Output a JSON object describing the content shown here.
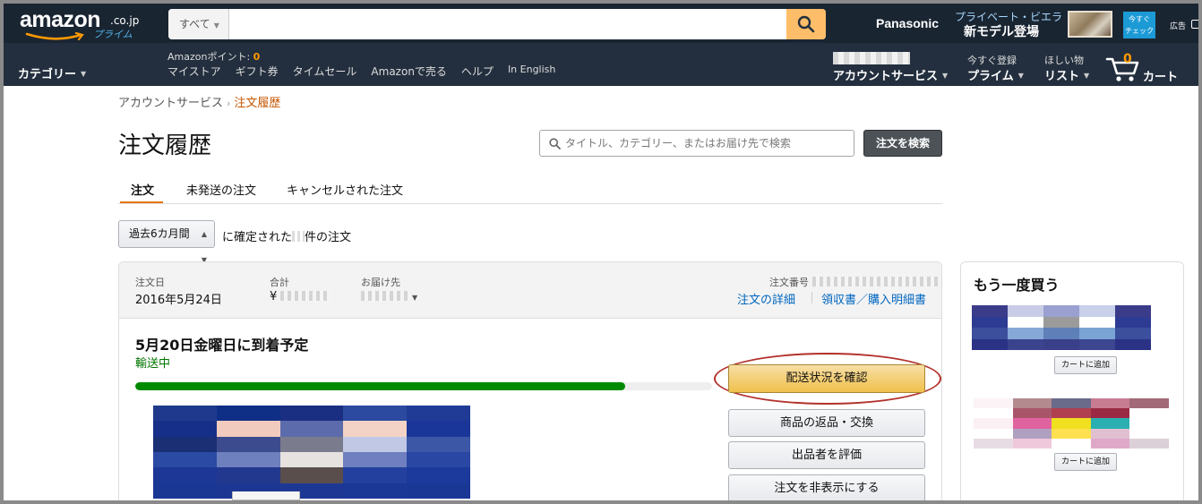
{
  "nav": {
    "logo_word": "amazon",
    "logo_cojp": ".co.jp",
    "logo_prime": "プライム",
    "search_category": "すべて",
    "search_placeholder": "",
    "ad_brand": "Panasonic",
    "ad_line1": "プライベート・ビエラ",
    "ad_line2": "新モデル登場",
    "ad_badge_line1": "今すぐ",
    "ad_badge_line2": "チェック",
    "ad_tag": "広告",
    "category_menu": "カテゴリー",
    "points_label": "Amazonポイント: ",
    "points_value": "0",
    "links": [
      "マイストア",
      "ギフト券",
      "タイムセール",
      "Amazonで売る",
      "ヘルプ",
      "In English"
    ],
    "account_main": "アカウントサービス",
    "prime_small": "今すぐ登録",
    "prime_main": "プライム",
    "list_small": "ほしい物",
    "list_main": "リスト",
    "cart_count": "0",
    "cart_label": "カート"
  },
  "breadcrumb": {
    "parent": "アカウントサービス",
    "separator": "›",
    "current": "注文履歴"
  },
  "page": {
    "title": "注文履歴",
    "search_placeholder": "タイトル、カテゴリー、またはお届け先で検索",
    "search_button": "注文を検索"
  },
  "tabs": [
    "注文",
    "未発送の注文",
    "キャンセルされた注文"
  ],
  "range": {
    "selected": "過去6カ月間",
    "text_prefix": "に確定された",
    "text_suffix": "件の注文"
  },
  "order": {
    "date_label": "注文日",
    "date_value": "2016年5月24日",
    "total_label": "合計",
    "total_currency": "¥",
    "ship_label": "お届け先",
    "number_label": "注文番号",
    "link_details": "注文の詳細",
    "link_receipt": "領収書／購入明細書",
    "arrival": "5月20日金曜日に到着予定",
    "status": "輸送中",
    "progress_percent": 85,
    "btn_track": "配送状況を確認",
    "btn_return": "商品の返品・交換",
    "btn_review": "出品者を評価",
    "btn_hide": "注文を非表示にする"
  },
  "sidebar": {
    "title": "もう一度買う",
    "add_to_cart": "カートに追加"
  },
  "colors": {
    "nav_bg": "#232f3e",
    "nav_top": "#1a2532",
    "accent_orange": "#f90",
    "link_blue": "#0066c0",
    "status_green": "#007600",
    "progress_green": "#008a00",
    "highlight_red": "#b3312b"
  }
}
